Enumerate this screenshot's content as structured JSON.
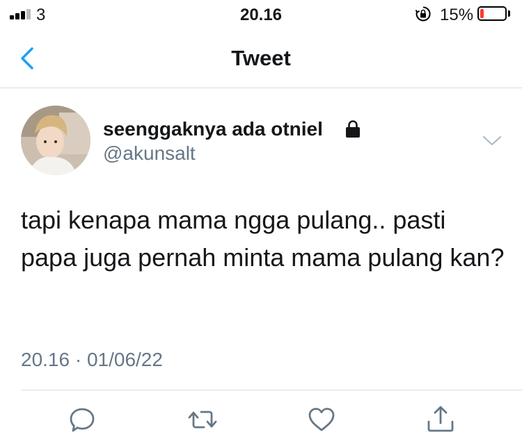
{
  "status_bar": {
    "carrier": "3",
    "time": "20.16",
    "battery_percent": "15%",
    "battery_level": 0.15,
    "battery_color": "#ff3b30"
  },
  "nav": {
    "title": "Tweet",
    "back_icon": "chevron-left-icon",
    "accent_color": "#1da1f2"
  },
  "tweet": {
    "display_name": "seenggaknya ada otniel",
    "handle": "@akunsalt",
    "protected_icon": "lock-icon",
    "text": "tapi kenapa mama ngga pulang.. pasti papa juga pernah minta mama pulang kan?",
    "timestamp": "20.16 · 01/06/22"
  },
  "actions": [
    {
      "name": "reply",
      "icon": "reply-icon"
    },
    {
      "name": "retweet",
      "icon": "retweet-icon"
    },
    {
      "name": "like",
      "icon": "heart-icon"
    },
    {
      "name": "share",
      "icon": "share-icon"
    }
  ]
}
